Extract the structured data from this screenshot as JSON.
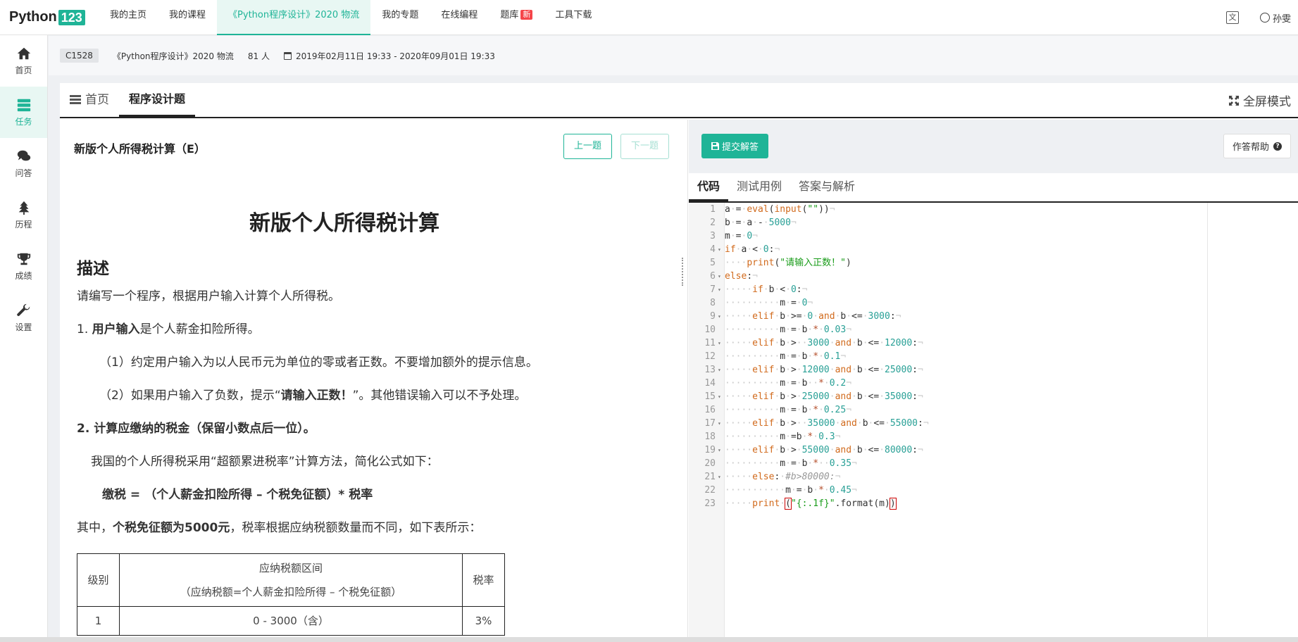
{
  "logo": {
    "text": "Python",
    "num": "123"
  },
  "nav": {
    "items": [
      "我的主页",
      "我的课程",
      "《Python程序设计》2020 物流",
      "我的专题",
      "在线编程",
      "题库",
      "工具下载"
    ],
    "new_badge": "新"
  },
  "user": {
    "name": "孙雯"
  },
  "sidebar": {
    "items": [
      {
        "label": "首页",
        "icon": "home-icon"
      },
      {
        "label": "任务",
        "icon": "task-icon"
      },
      {
        "label": "问答",
        "icon": "chat-icon"
      },
      {
        "label": "历程",
        "icon": "tree-icon"
      },
      {
        "label": "成绩",
        "icon": "trophy-icon"
      },
      {
        "label": "设置",
        "icon": "wrench-icon"
      }
    ]
  },
  "course": {
    "code": "C1528",
    "name": "《Python程序设计》2020 物流",
    "members": "81 人",
    "date_range": "2019年02月11日 19:33 - 2020年09月01日 19:33"
  },
  "tabs": {
    "home": "首页",
    "programming": "程序设计题",
    "fullscreen": "全屏模式"
  },
  "problem": {
    "header": "新版个人所得税计算（E）",
    "prev": "上一题",
    "next": "下一题",
    "title": "新版个人所得税计算",
    "section": "描述",
    "p1": "请编写一个程序，根据用户输入计算个人所得税。",
    "p2_num": "1. ",
    "p2_bold": "用户输入",
    "p2_rest": "是个人薪金扣险所得。",
    "p3": "（1）约定用户输入为以人民币元为单位的零或者正数。不要增加额外的提示信息。",
    "p4_a": "（2）如果用户输入了负数，提示“",
    "p4_bold": "请输入正数！",
    "p4_b": "”。其他错误输入可以不予处理。",
    "p5_bold": "2. 计算应缴纳的税金",
    "p5_rest": "（保留小数点后一位）。",
    "p6": "我国的个人所得税采用“超额累进税率”计算方法，简化公式如下：",
    "p7": "缴税 = （个人薪金扣险所得 – 个税免征额）* 税率",
    "p8_a": "其中，",
    "p8_bold": "个税免征额为5000元",
    "p8_b": "，税率根据应纳税额数量而不同，如下表所示："
  },
  "table": {
    "h_level": "级别",
    "h_range": "应纳税额区间",
    "h_range_note": "（应纳税额=个人薪金扣险所得 – 个税免征额）",
    "h_rate": "税率",
    "rows": [
      {
        "level": "1",
        "range": "0 - 3000（含）",
        "rate": "3%"
      }
    ]
  },
  "editor": {
    "submit": "提交解答",
    "help": "作答帮助",
    "tabs": [
      "代码",
      "测试用例",
      "答案与解析"
    ]
  }
}
